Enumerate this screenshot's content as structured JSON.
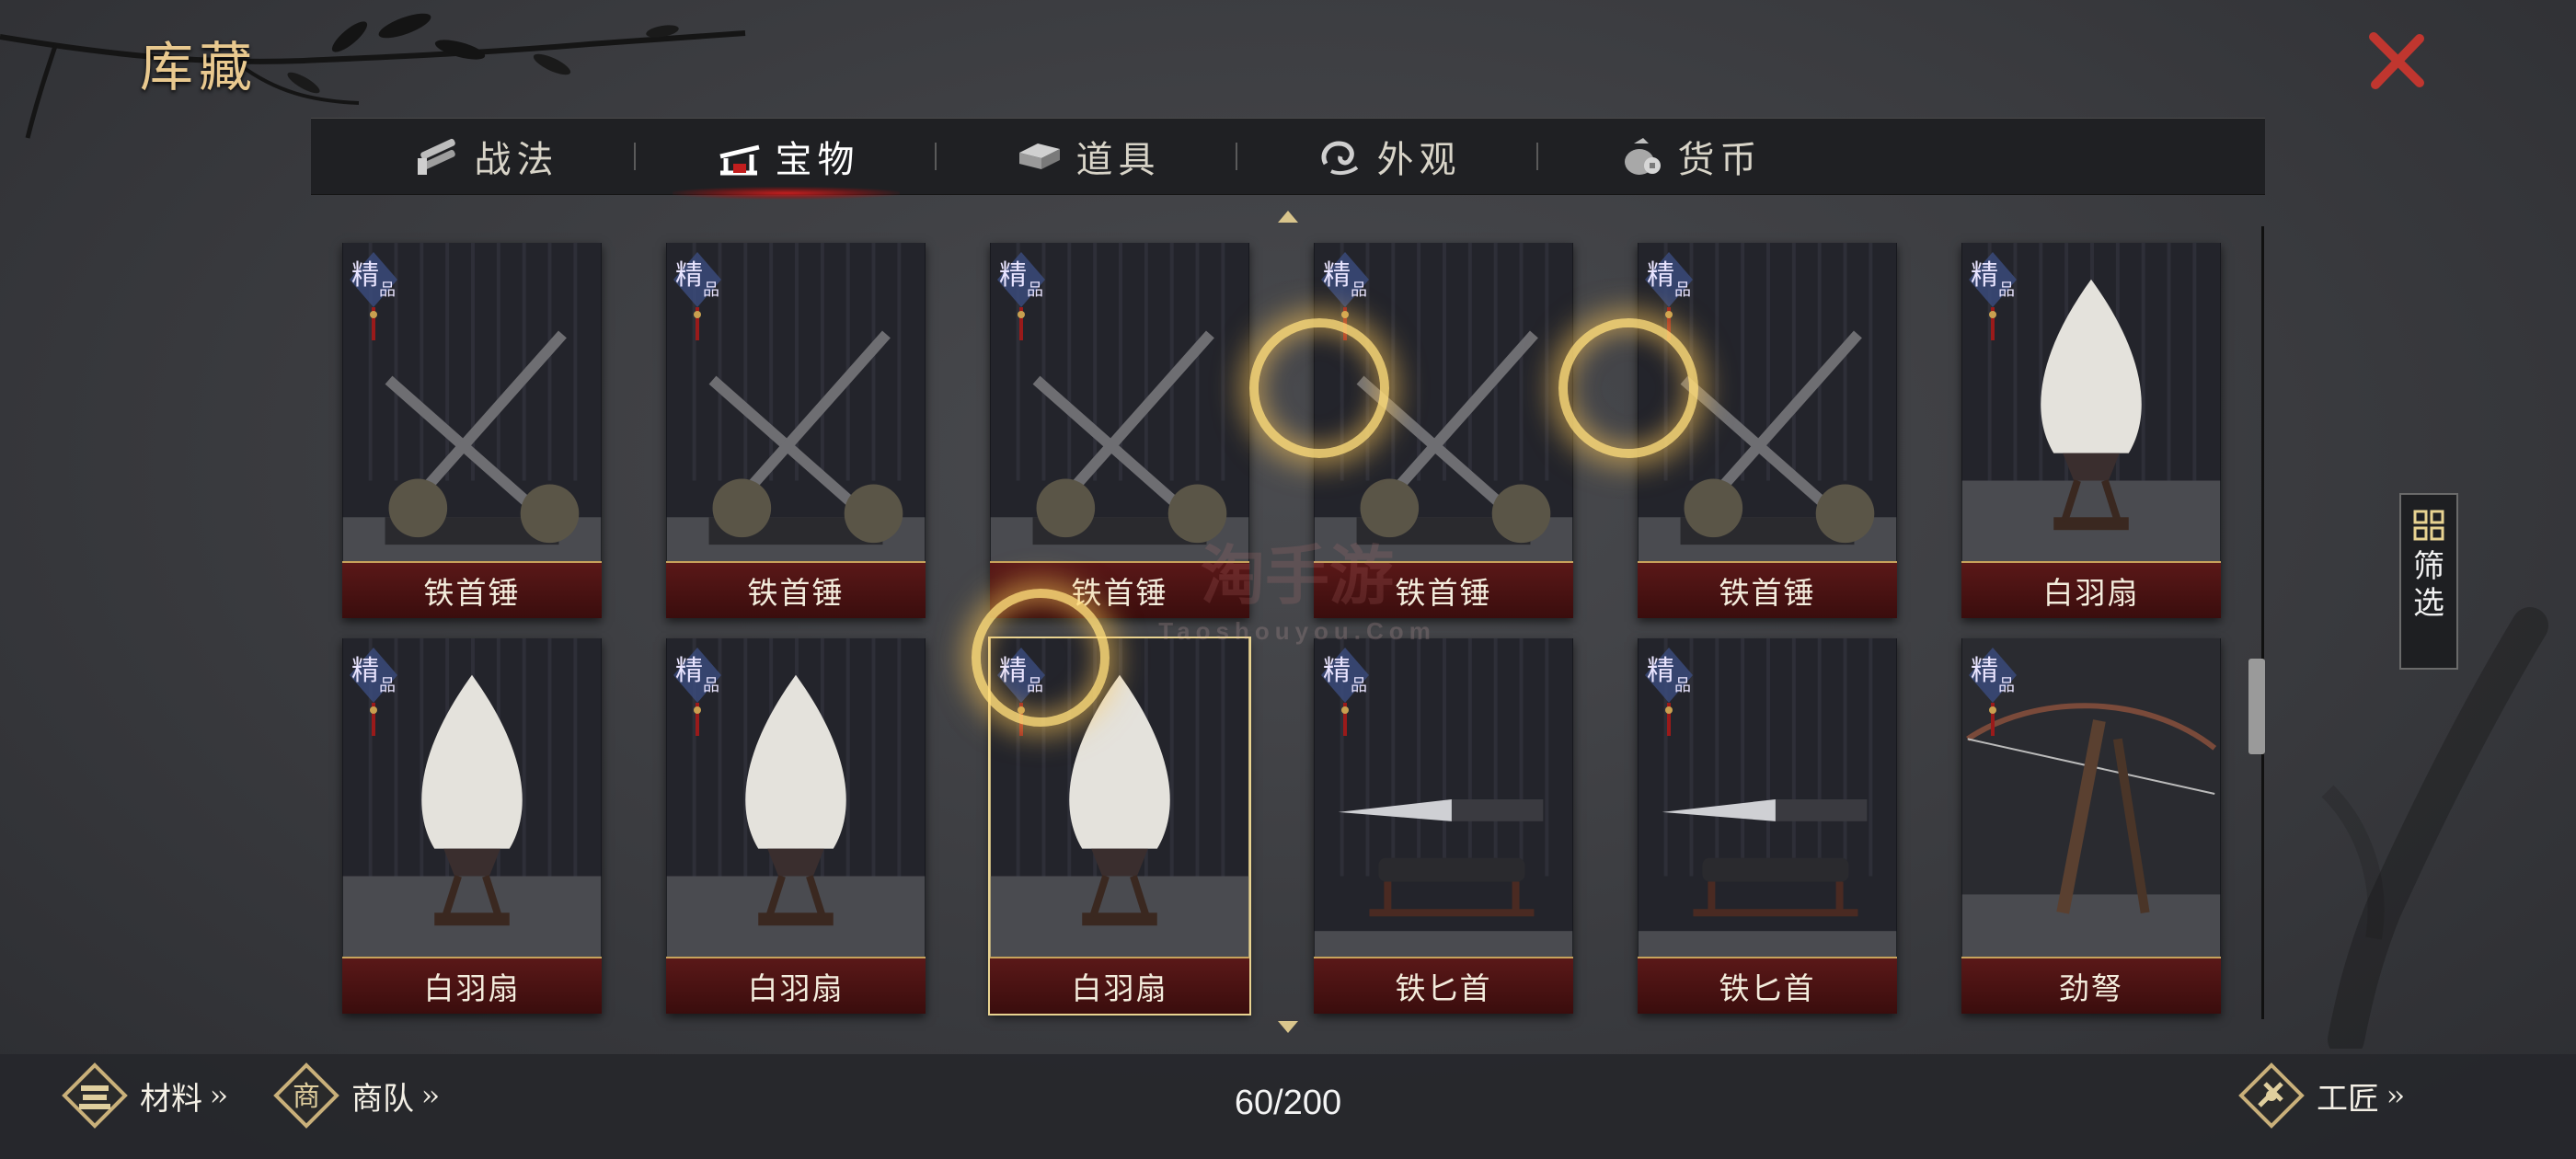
{
  "header": {
    "title": "库藏"
  },
  "tabs": [
    {
      "label": "战法",
      "icon": "scroll-bundle-icon",
      "active": false
    },
    {
      "label": "宝物",
      "icon": "treasure-stand-icon",
      "active": true
    },
    {
      "label": "道具",
      "icon": "ingot-chest-icon",
      "active": false
    },
    {
      "label": "外观",
      "icon": "swirl-cloud-icon",
      "active": false
    },
    {
      "label": "货币",
      "icon": "money-bag-icon",
      "active": false
    }
  ],
  "items": [
    {
      "name": "铁首锤",
      "grade": "精品",
      "art": "hammer"
    },
    {
      "name": "铁首锤",
      "grade": "精品",
      "art": "hammer"
    },
    {
      "name": "铁首锤",
      "grade": "精品",
      "art": "hammer"
    },
    {
      "name": "铁首锤",
      "grade": "精品",
      "art": "hammer"
    },
    {
      "name": "铁首锤",
      "grade": "精品",
      "art": "hammer"
    },
    {
      "name": "白羽扇",
      "grade": "精品",
      "art": "fan"
    },
    {
      "name": "白羽扇",
      "grade": "精品",
      "art": "fan"
    },
    {
      "name": "白羽扇",
      "grade": "精品",
      "art": "fan"
    },
    {
      "name": "白羽扇",
      "grade": "精品",
      "art": "fan",
      "selected": true
    },
    {
      "name": "铁匕首",
      "grade": "精品",
      "art": "dagger"
    },
    {
      "name": "铁匕首",
      "grade": "精品",
      "art": "dagger"
    },
    {
      "name": "劲弩",
      "grade": "精品",
      "art": "crossbow"
    }
  ],
  "filter": {
    "label": "筛选"
  },
  "footer": {
    "materials": "材料",
    "caravan": "商队",
    "caravan_emblem": "商",
    "craftsman": "工匠",
    "count": "60/200"
  },
  "watermark": {
    "main": "淘手游",
    "sub": "Taoshouyou.Com"
  },
  "colors": {
    "accent_gold": "#e9c98f",
    "label_red": "#4a1212",
    "close_red": "#c0362f"
  }
}
